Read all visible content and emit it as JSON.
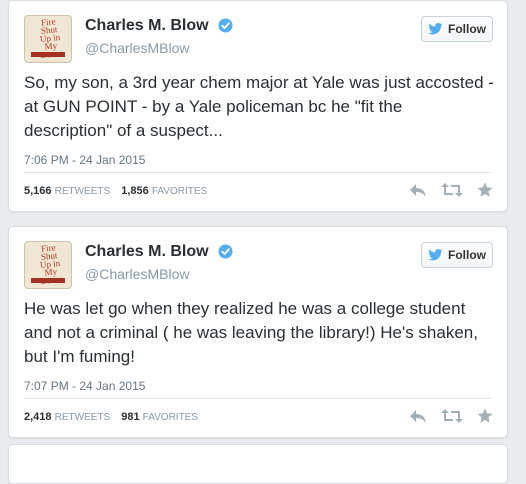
{
  "tweets": [
    {
      "author_name": "Charles M. Blow",
      "handle": "@CharlesMBlow",
      "follow_label": "Follow",
      "text": "So, my son, a 3rd year chem major at Yale was just accosted - at GUN POINT - by a Yale policeman bc he \"fit the description\" of a suspect...",
      "timestamp": "7:06 PM - 24 Jan 2015",
      "retweets": "5,166",
      "retweets_label": "RETWEETS",
      "favorites": "1,856",
      "favorites_label": "FAVORITES"
    },
    {
      "author_name": "Charles M. Blow",
      "handle": "@CharlesMBlow",
      "follow_label": "Follow",
      "text": "He was let go when they realized he was a college student and not a criminal ( he was leaving the library!) He's shaken, but I'm fuming!",
      "timestamp": "7:07 PM - 24 Jan 2015",
      "retweets": "2,418",
      "retweets_label": "RETWEETS",
      "favorites": "981",
      "favorites_label": "FAVORITES"
    }
  ],
  "avatar": {
    "cover_lines": [
      "Fire",
      "Shut",
      "Up in",
      "My",
      "Bones"
    ],
    "cover_author": "CHARLES M. BLOW"
  },
  "colors": {
    "verified_badge": "#55acee",
    "twitter_blue": "#55acee",
    "text": "#292f33",
    "muted": "#8899a6"
  },
  "icons": [
    "verified-icon",
    "twitter-bird-icon",
    "reply-icon",
    "retweet-icon",
    "favorite-icon"
  ]
}
